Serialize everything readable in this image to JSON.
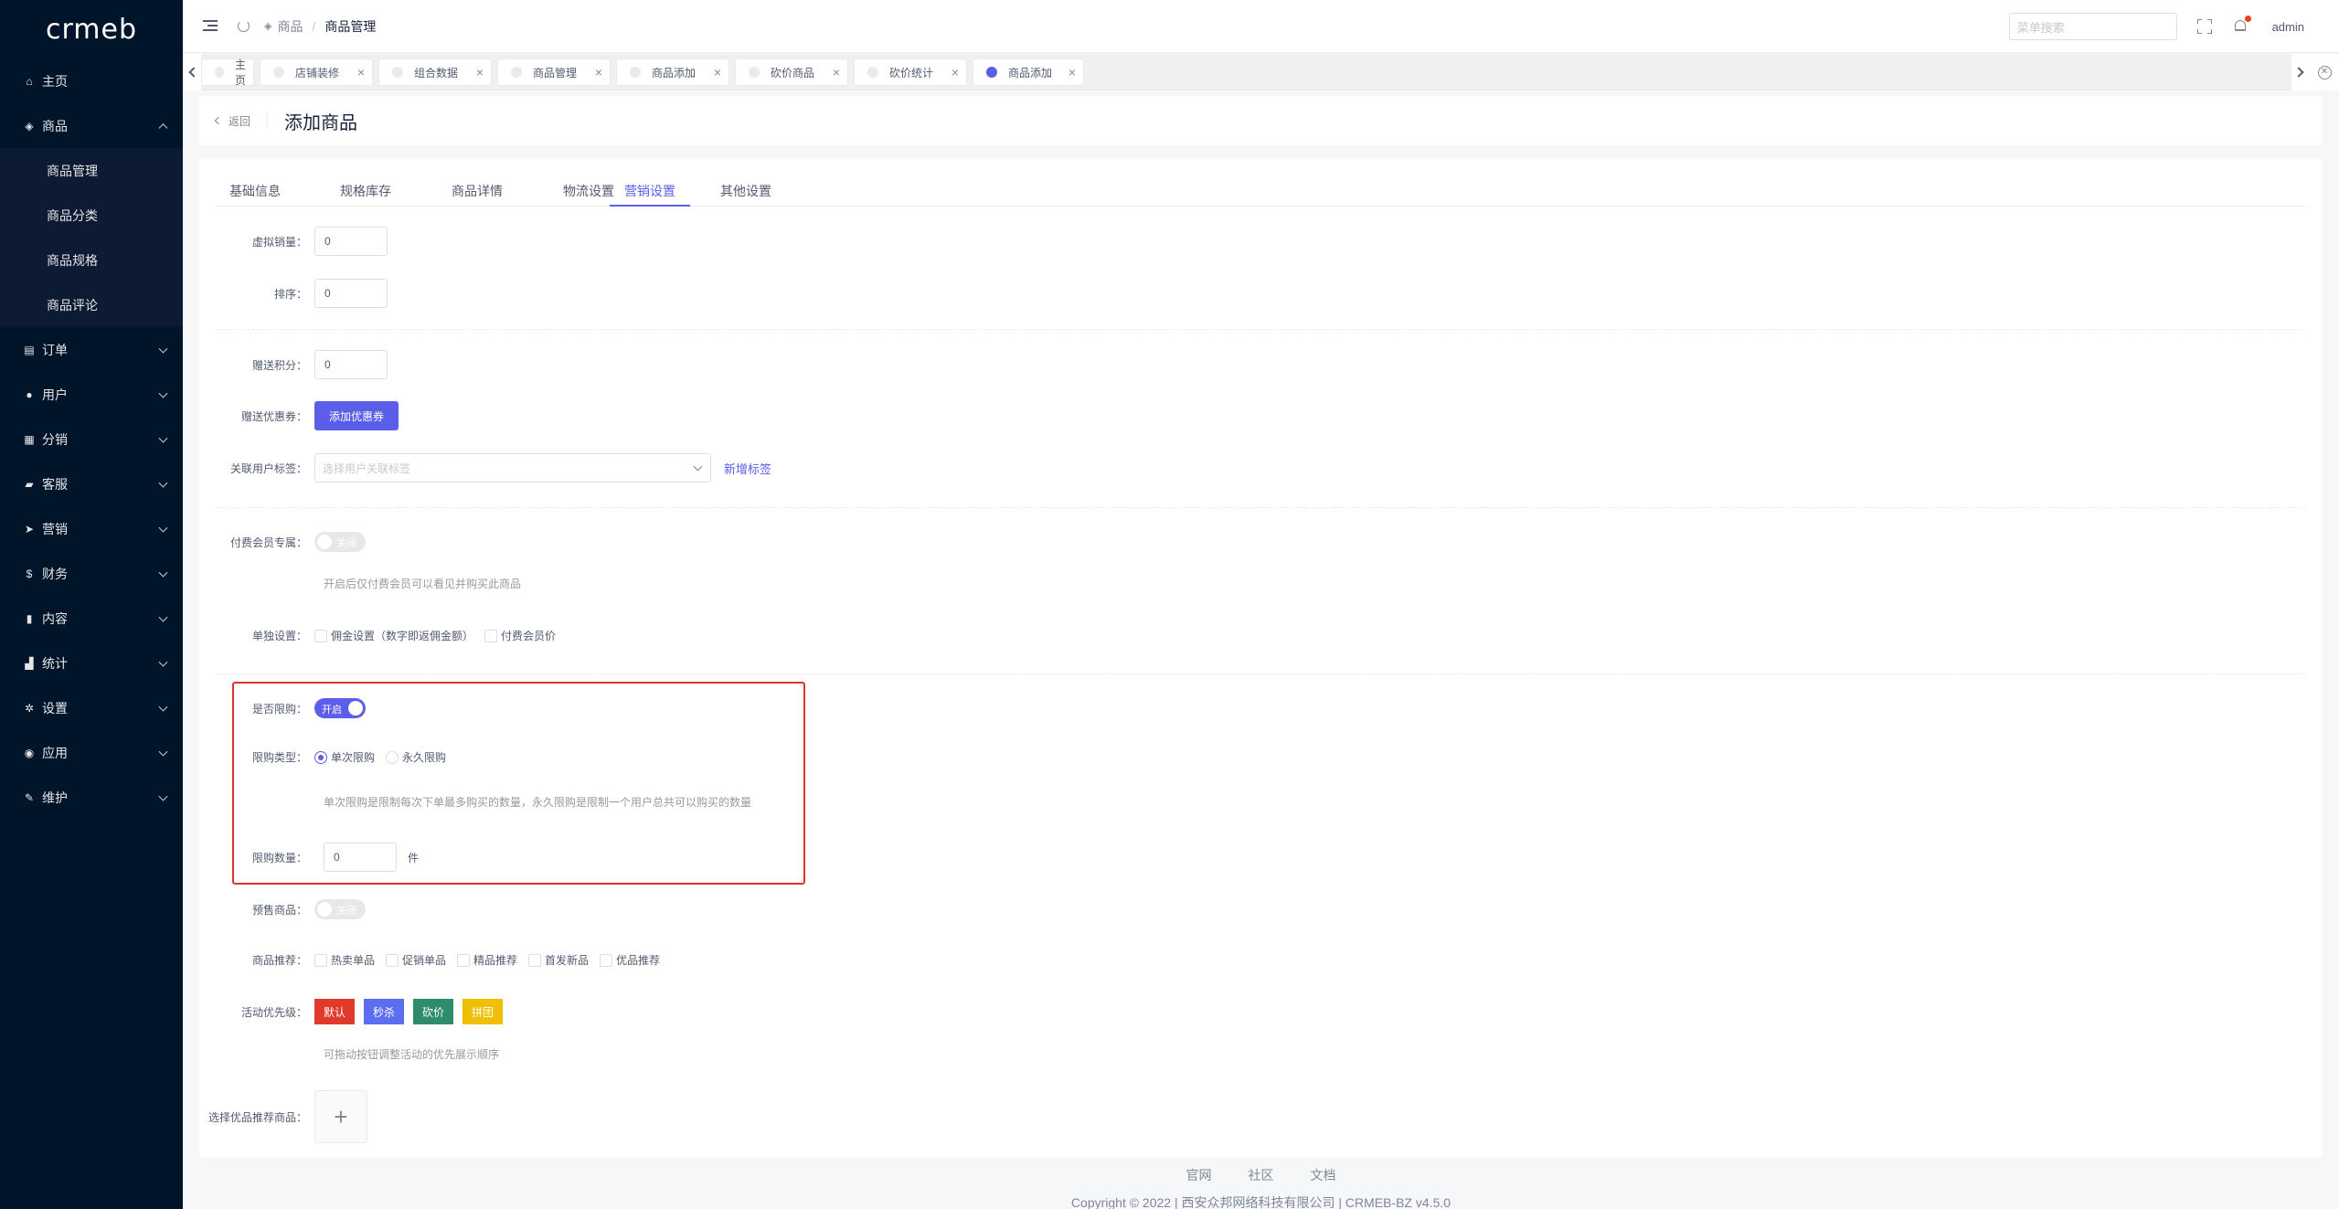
{
  "logo": "crmeb",
  "sidebar": {
    "items": [
      {
        "label": "主页",
        "icon": "home-icon",
        "glyph": "⌂"
      },
      {
        "label": "商品",
        "icon": "product-icon",
        "glyph": "◈",
        "expanded": true
      },
      {
        "label": "订单",
        "icon": "order-icon",
        "glyph": "▤"
      },
      {
        "label": "用户",
        "icon": "user-icon",
        "glyph": "●"
      },
      {
        "label": "分销",
        "icon": "distribution-icon",
        "glyph": "▦"
      },
      {
        "label": "客服",
        "icon": "chat-icon",
        "glyph": "▰"
      },
      {
        "label": "营销",
        "icon": "marketing-icon",
        "glyph": "➤"
      },
      {
        "label": "财务",
        "icon": "finance-icon",
        "glyph": "$"
      },
      {
        "label": "内容",
        "icon": "content-icon",
        "glyph": "▮"
      },
      {
        "label": "统计",
        "icon": "stats-icon",
        "glyph": "▟"
      },
      {
        "label": "设置",
        "icon": "settings-icon",
        "glyph": "✲"
      },
      {
        "label": "应用",
        "icon": "app-icon",
        "glyph": "◉"
      },
      {
        "label": "维护",
        "icon": "maintain-icon",
        "glyph": "✎"
      }
    ],
    "subitems": [
      "商品管理",
      "商品分类",
      "商品规格",
      "商品评论"
    ]
  },
  "header": {
    "breadcrumb": [
      "商品",
      "商品管理"
    ],
    "search_placeholder": "菜单搜索",
    "user": "admin"
  },
  "tabs": [
    {
      "label": "主页",
      "closable": false
    },
    {
      "label": "店铺装修",
      "closable": true
    },
    {
      "label": "组合数据",
      "closable": true
    },
    {
      "label": "商品管理",
      "closable": true
    },
    {
      "label": "商品添加",
      "closable": true
    },
    {
      "label": "砍价商品",
      "closable": true
    },
    {
      "label": "砍价统计",
      "closable": true
    },
    {
      "label": "商品添加",
      "closable": true,
      "active": true
    }
  ],
  "page": {
    "back": "返回",
    "title": "添加商品"
  },
  "form_tabs": [
    "基础信息",
    "规格库存",
    "商品详情",
    "物流设置",
    "营销设置",
    "其他设置"
  ],
  "form": {
    "virtual_sales": {
      "label": "虚拟销量",
      "value": "0"
    },
    "sort": {
      "label": "排序",
      "value": "0"
    },
    "give_points": {
      "label": "赠送积分",
      "value": "0"
    },
    "give_coupon": {
      "label": "赠送优惠券",
      "button": "添加优惠券"
    },
    "user_tags": {
      "label": "关联用户标签",
      "placeholder": "选择用户关联标签",
      "link": "新增标签"
    },
    "vip_only": {
      "label": "付费会员专属",
      "state": "关闭",
      "hint": "开启后仅付费会员可以看见并购买此商品"
    },
    "single_settings": {
      "label": "单独设置",
      "options": [
        "佣金设置（数字即返佣金额）",
        "付费会员价"
      ]
    },
    "limit_buy": {
      "label": "是否限购",
      "state": "开启"
    },
    "limit_type": {
      "label": "限购类型",
      "options": [
        "单次限购",
        "永久限购"
      ],
      "selected": "单次限购",
      "hint": "单次限购是限制每次下单最多购买的数量，永久限购是限制一个用户总共可以购买的数量"
    },
    "limit_count": {
      "label": "限购数量",
      "value": "0",
      "unit": "件"
    },
    "presale": {
      "label": "预售商品",
      "state": "关闭"
    },
    "recommend": {
      "label": "商品推荐",
      "options": [
        "热卖单品",
        "促销单品",
        "精品推荐",
        "首发新品",
        "优品推荐"
      ]
    },
    "activity_priority": {
      "label": "活动优先级",
      "items": [
        {
          "label": "默认",
          "color": "#e03b2a"
        },
        {
          "label": "秒杀",
          "color": "#5b6ef0"
        },
        {
          "label": "砍价",
          "color": "#2d8c6c"
        },
        {
          "label": "拼团",
          "color": "#f0c000"
        }
      ],
      "hint": "可拖动按钮调整活动的优先展示顺序"
    },
    "recommend_goods": {
      "label": "选择优品推荐商品",
      "add": "+"
    }
  },
  "footer": {
    "links": [
      "官网",
      "社区",
      "文档"
    ],
    "copyright": "Copyright © 2022 | 西安众邦网络科技有限公司 | CRMEB-BZ v4.5.0"
  }
}
